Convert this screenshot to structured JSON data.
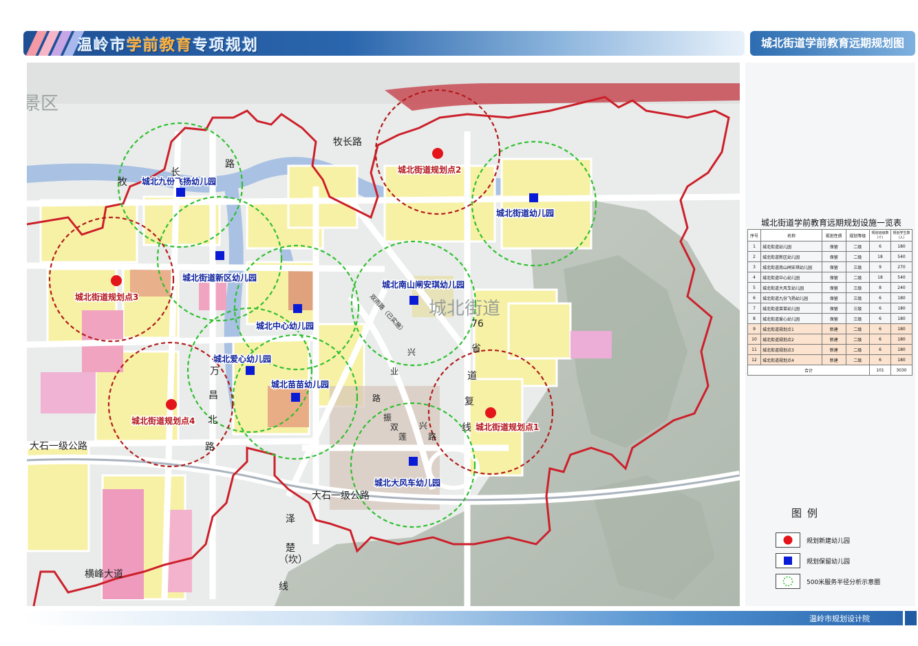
{
  "header": {
    "title_pre": "温岭市",
    "title_hl": "学前教育",
    "title_post": "专项规划",
    "right_title": "城北街道学前教育远期规划图"
  },
  "map": {
    "district_label": "城北街道",
    "road_labels": {
      "muchang_lu": "牧长路",
      "mu": "牧",
      "chang": "长",
      "lu": "路",
      "dashi_1": "大石一级公路",
      "dashi_2": "大石一级公路",
      "hengfeng": "横峰大道",
      "wan": "万",
      "chang2": "昌",
      "bei": "北",
      "lu2": "路",
      "ze": "泽",
      "chu": "楚",
      "kan": "（坎）",
      "xian": "线",
      "s76": "76",
      "sheng": "省",
      "dao": "道",
      "fu": "复",
      "xian2": "线",
      "shuangyu": "双雨路（已实施）",
      "xing": "兴",
      "ye": "业",
      "lu3": "路",
      "zhen": "振",
      "shuang": "双",
      "lian": "莲",
      "xing2": "兴",
      "lu4": "路",
      "jing_qu": "景区"
    },
    "kindergartens": [
      {
        "name": "城北九份飞扬幼儿园",
        "type": "retained"
      },
      {
        "name": "城北街道新区幼儿园",
        "type": "retained"
      },
      {
        "name": "城北中心幼儿园",
        "type": "retained"
      },
      {
        "name": "城北爱心幼儿园",
        "type": "retained"
      },
      {
        "name": "城北苗苗幼儿园",
        "type": "retained"
      },
      {
        "name": "城北南山闸安琪幼儿园",
        "type": "retained"
      },
      {
        "name": "城北街道幼儿园",
        "type": "retained"
      },
      {
        "name": "城北大风车幼儿园",
        "type": "retained"
      },
      {
        "name": "城北街道规划点1",
        "type": "new"
      },
      {
        "name": "城北街道规划点2",
        "type": "new"
      },
      {
        "name": "城北街道规划点3",
        "type": "new"
      },
      {
        "name": "城北街道规划点4",
        "type": "new"
      }
    ],
    "colors": {
      "boundary": "#cc1f2a",
      "new_circle": "#b31a1a",
      "retained_circle": "#2fbf2f",
      "new_marker": "#e3151b",
      "retained_marker": "#0a1bd6",
      "new_label": "#b3141a",
      "retained_label": "#0b1f9c"
    }
  },
  "table": {
    "title": "城北街道学前教育远期规划设施一览表",
    "headers": [
      "序号",
      "名称",
      "规划性质",
      "规划等级",
      "规划班级数（个）",
      "规划学生数（人）"
    ],
    "rows": [
      [
        "1",
        "城北街道幼儿园",
        "保留",
        "二级",
        "6",
        "180"
      ],
      [
        "2",
        "城北街道新区幼儿园",
        "保留",
        "二级",
        "18",
        "540"
      ],
      [
        "3",
        "城北街道南山闸安琪幼儿园",
        "保留",
        "三级",
        "9",
        "270"
      ],
      [
        "4",
        "城北街道中心幼儿园",
        "保留",
        "二级",
        "18",
        "540"
      ],
      [
        "5",
        "城北街道大风车幼儿园",
        "保留",
        "三级",
        "8",
        "240"
      ],
      [
        "6",
        "城北街道九份飞扬幼儿园",
        "保留",
        "三级",
        "6",
        "180"
      ],
      [
        "7",
        "城北街道苗苗幼儿园",
        "保留",
        "三级",
        "6",
        "180"
      ],
      [
        "8",
        "城北街道爱心幼儿园",
        "保留",
        "三级",
        "6",
        "180"
      ],
      [
        "9",
        "城北街道规划点1",
        "新建",
        "二级",
        "6",
        "180"
      ],
      [
        "10",
        "城北街道规划点2",
        "新建",
        "二级",
        "6",
        "180"
      ],
      [
        "11",
        "城北街道规划点3",
        "新建",
        "二级",
        "6",
        "180"
      ],
      [
        "12",
        "城北街道规划点4",
        "新建",
        "二级",
        "6",
        "180"
      ]
    ],
    "total_label": "合计",
    "total_classes": "101",
    "total_students": "3030"
  },
  "legend": {
    "title": "图例",
    "items": [
      {
        "label": "规划新建幼儿园",
        "icon": "red-circle-icon"
      },
      {
        "label": "规划保留幼儿园",
        "icon": "blue-square-icon"
      },
      {
        "label": "500米服务半径分析示意圈",
        "icon": "green-dashed-circle-icon"
      }
    ]
  },
  "footer": {
    "org": "温岭市规划设计院"
  }
}
